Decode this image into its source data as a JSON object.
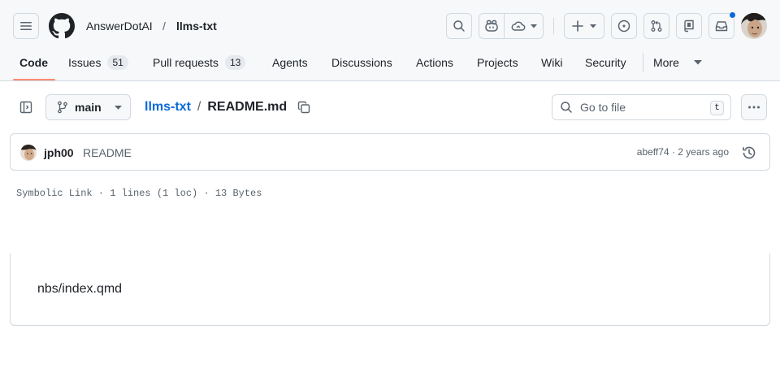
{
  "breadcrumb": {
    "owner": "AnswerDotAI",
    "separator": "/",
    "repo": "llms-txt"
  },
  "tabs": [
    {
      "label": "Code",
      "active": true
    },
    {
      "label": "Issues",
      "count": "51"
    },
    {
      "label": "Pull requests",
      "count": "13"
    },
    {
      "label": "Agents"
    },
    {
      "label": "Discussions"
    },
    {
      "label": "Actions"
    },
    {
      "label": "Projects"
    },
    {
      "label": "Wiki"
    },
    {
      "label": "Security"
    },
    {
      "label": "More"
    }
  ],
  "file_header": {
    "branch": "main",
    "repo": "llms-txt",
    "separator": "/",
    "filename": "README.md",
    "search_placeholder": "Go to file",
    "search_shortcut": "t"
  },
  "commit": {
    "author": "jph00",
    "message": "README",
    "sha": "abeff74",
    "dot": " · ",
    "time": "2 years ago"
  },
  "file_info": "Symbolic Link · 1 lines (1 loc) · 13 Bytes",
  "content": "nbs/index.qmd",
  "colors": {
    "accent": "#0969da",
    "tab_underline": "#fd8c73",
    "notification": "#0969da",
    "header_bg": "#f6f8fa",
    "border": "#d1d9e0"
  },
  "icons": [
    "hamburger-menu-icon",
    "github-logo-icon",
    "search-icon",
    "copilot-icon",
    "cloud-icon",
    "plus-icon",
    "issue-icon",
    "pull-request-icon",
    "repo-icon",
    "inbox-icon",
    "sidebar-toggle-icon",
    "branch-icon",
    "copy-icon",
    "kebab-icon",
    "history-icon"
  ]
}
